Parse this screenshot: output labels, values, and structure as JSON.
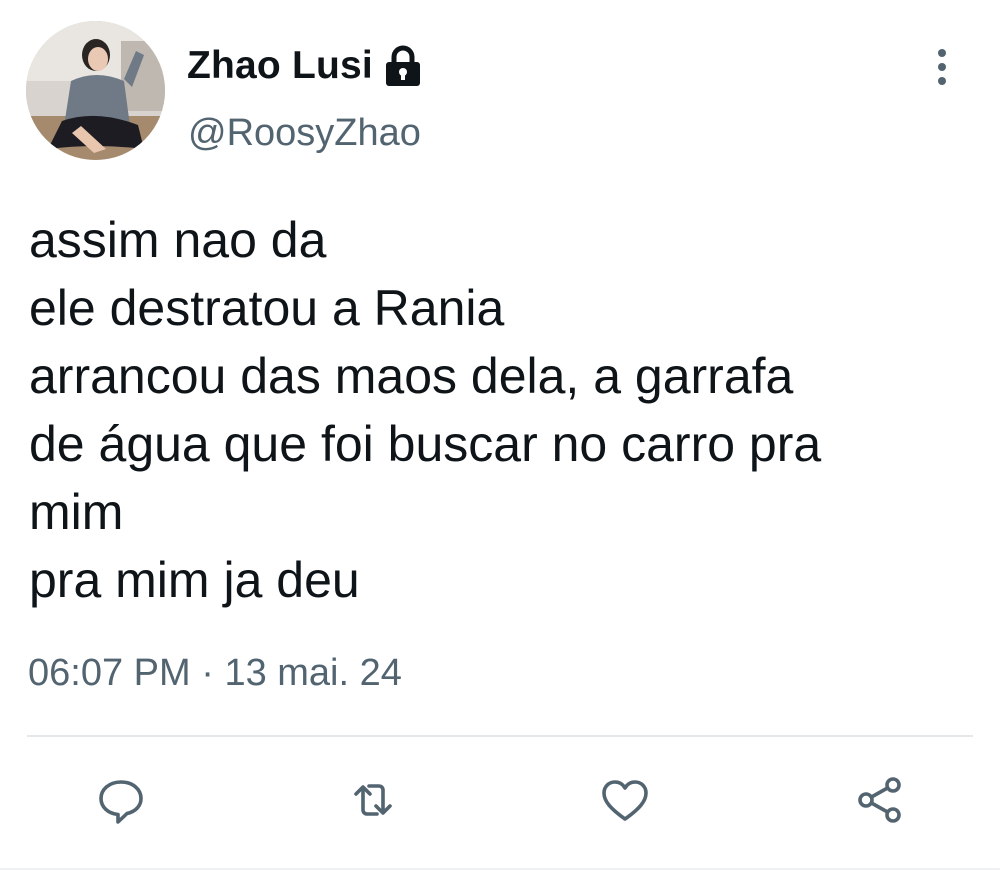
{
  "author": {
    "display_name": "Zhao Lusi",
    "handle": "@RoosyZhao",
    "protected_icon": "lock-icon",
    "avatar": "profile-photo"
  },
  "tweet": {
    "lines": [
      "assim nao da",
      "ele destratou a Rania",
      "arrancou das maos dela, a garrafa",
      "de água que foi buscar no carro pra",
      "mim",
      "pra mim ja deu"
    ],
    "time": "06:07 PM",
    "separator": "·",
    "date": "13 mai. 24"
  },
  "actions": [
    {
      "name": "reply",
      "icon": "comment-icon"
    },
    {
      "name": "retweet",
      "icon": "retweet-icon"
    },
    {
      "name": "like",
      "icon": "heart-icon"
    },
    {
      "name": "share",
      "icon": "share-icon"
    }
  ],
  "colors": {
    "text": "#0f1419",
    "secondary": "#536471",
    "divider": "#e4e8eb"
  }
}
